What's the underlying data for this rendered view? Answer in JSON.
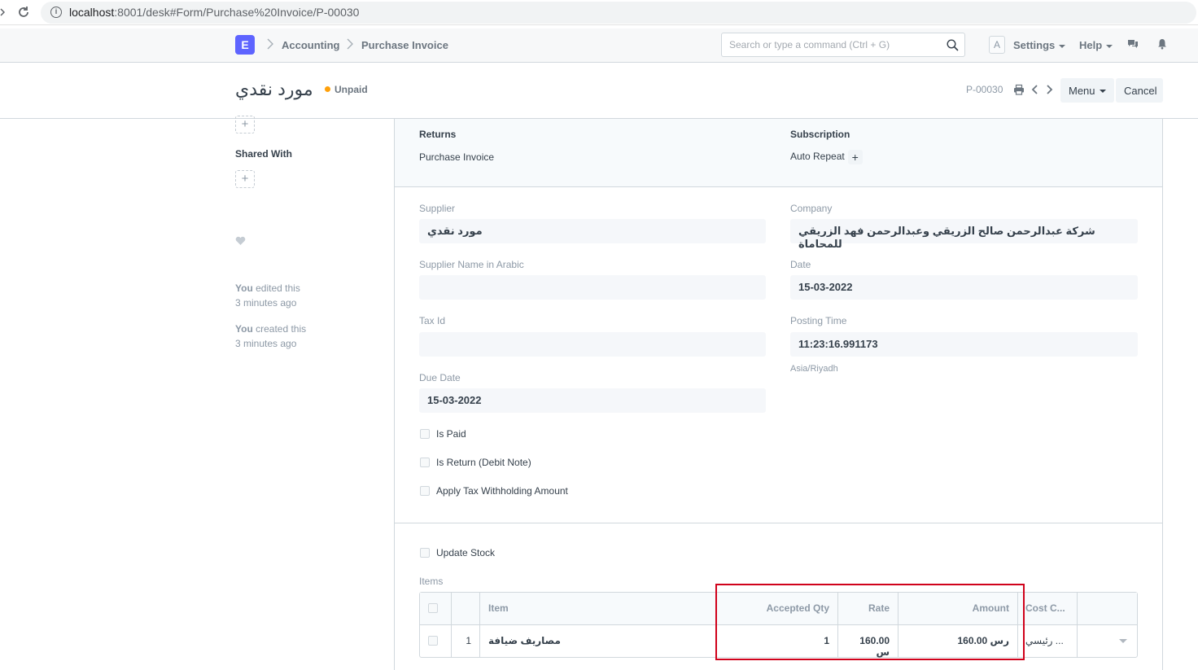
{
  "browser": {
    "url_host": "localhost",
    "url_path": ":8001/desk#Form/Purchase%20Invoice/P-00030"
  },
  "navbar": {
    "logo": "E",
    "breadcrumbs": [
      "Accounting",
      "Purchase Invoice"
    ],
    "search_placeholder": "Search or type a command (Ctrl + G)",
    "avatar": "A",
    "settings": "Settings",
    "help": "Help"
  },
  "page": {
    "title": "مورد نقدي",
    "status": "Unpaid",
    "status_color": "#ffa00a",
    "doc_name": "P-00030",
    "menu_label": "Menu",
    "cancel_label": "Cancel"
  },
  "sidebar": {
    "shared_with": "Shared With",
    "activity": [
      {
        "who": "You",
        "action": " edited this",
        "when": "3 minutes ago"
      },
      {
        "who": "You",
        "action": " created this",
        "when": "3 minutes ago"
      }
    ]
  },
  "connections": {
    "returns_title": "Returns",
    "returns_link": "Purchase Invoice",
    "subscription_title": "Subscription",
    "subscription_link": "Auto Repeat"
  },
  "form": {
    "supplier_label": "Supplier",
    "supplier": "مورد نقدي",
    "supplier_arabic_label": "Supplier Name in Arabic",
    "supplier_arabic": "",
    "tax_id_label": "Tax Id",
    "tax_id": "",
    "due_date_label": "Due Date",
    "due_date": "15-03-2022",
    "company_label": "Company",
    "company": "شركة عبدالرحمن صالح الزريقي وعبدالرحمن فهد الزريقي للمحاماة",
    "date_label": "Date",
    "date": "15-03-2022",
    "posting_time_label": "Posting Time",
    "posting_time": "11:23:16.991173",
    "timezone": "Asia/Riyadh",
    "is_paid": "Is Paid",
    "is_return": "Is Return (Debit Note)",
    "apply_tax": "Apply Tax Withholding Amount",
    "update_stock": "Update Stock",
    "items_label": "Items"
  },
  "items_table": {
    "columns": [
      "Item",
      "Accepted Qty",
      "Rate",
      "Amount",
      "Cost C..."
    ],
    "rows": [
      {
        "idx": "1",
        "item": "مصاريف ضيافة",
        "qty": "1",
        "rate": "160.00 س",
        "amount": "160.00 رس",
        "cost_center": "رئيسي ..."
      }
    ]
  }
}
